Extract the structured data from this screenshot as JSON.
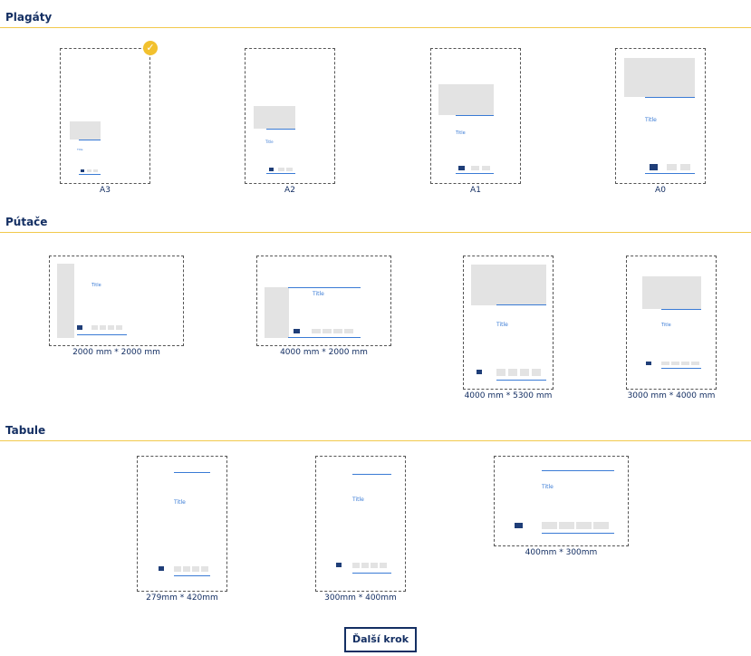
{
  "sections": [
    {
      "title": "Plagáty"
    },
    {
      "title": "Pútače"
    },
    {
      "title": "Tabule"
    }
  ],
  "posters": [
    {
      "label": "A3",
      "selected": true,
      "title_text": "Title"
    },
    {
      "label": "A2",
      "selected": false,
      "title_text": "Title"
    },
    {
      "label": "A1",
      "selected": false,
      "title_text": "Title"
    },
    {
      "label": "A0",
      "selected": false,
      "title_text": "Title"
    }
  ],
  "banners": [
    {
      "label": "2000 mm * 2000 mm",
      "title_text": "Title"
    },
    {
      "label": "4000 mm * 2000 mm",
      "title_text": "Title"
    },
    {
      "label": "4000 mm * 5300 mm",
      "title_text": "Title"
    },
    {
      "label": "3000 mm * 4000 mm",
      "title_text": "Title"
    }
  ],
  "boards": [
    {
      "label": "279mm * 420mm",
      "title_text": "Title"
    },
    {
      "label": "300mm * 400mm",
      "title_text": "Title"
    },
    {
      "label": "400mm * 300mm",
      "title_text": "Title"
    }
  ],
  "next_button": {
    "label": "Ďalší krok"
  },
  "colors": {
    "accent": "#f2c94c",
    "brand": "#142f63",
    "link": "#3a7bd5"
  },
  "icons": {
    "selected": "check-circle-icon"
  }
}
